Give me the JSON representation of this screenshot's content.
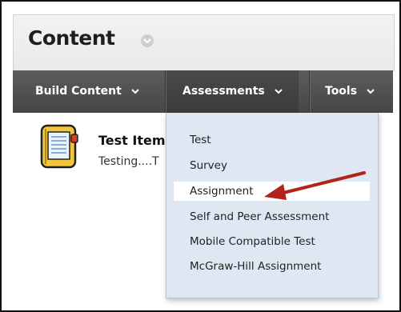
{
  "header": {
    "title": "Content"
  },
  "toolbar": {
    "build_content": "Build Content",
    "assessments": "Assessments",
    "tools": "Tools"
  },
  "content_item": {
    "title": "Test Item",
    "description": "Testing....T"
  },
  "menu": {
    "items": [
      {
        "label": "Test"
      },
      {
        "label": "Survey"
      },
      {
        "label": "Assignment"
      },
      {
        "label": "Self and Peer Assessment"
      },
      {
        "label": "Mobile Compatible Test"
      },
      {
        "label": "McGraw-Hill Assignment"
      }
    ],
    "highlighted": "Assignment"
  },
  "colors": {
    "toolbar_bg": "#4f4f4f",
    "menu_bg": "#dfe8f2",
    "arrow": "#b3231b",
    "notebook_icon": "#f2c53d"
  },
  "icons": [
    "chevron-down-icon",
    "notebook-icon",
    "red-arrow-annotation"
  ]
}
